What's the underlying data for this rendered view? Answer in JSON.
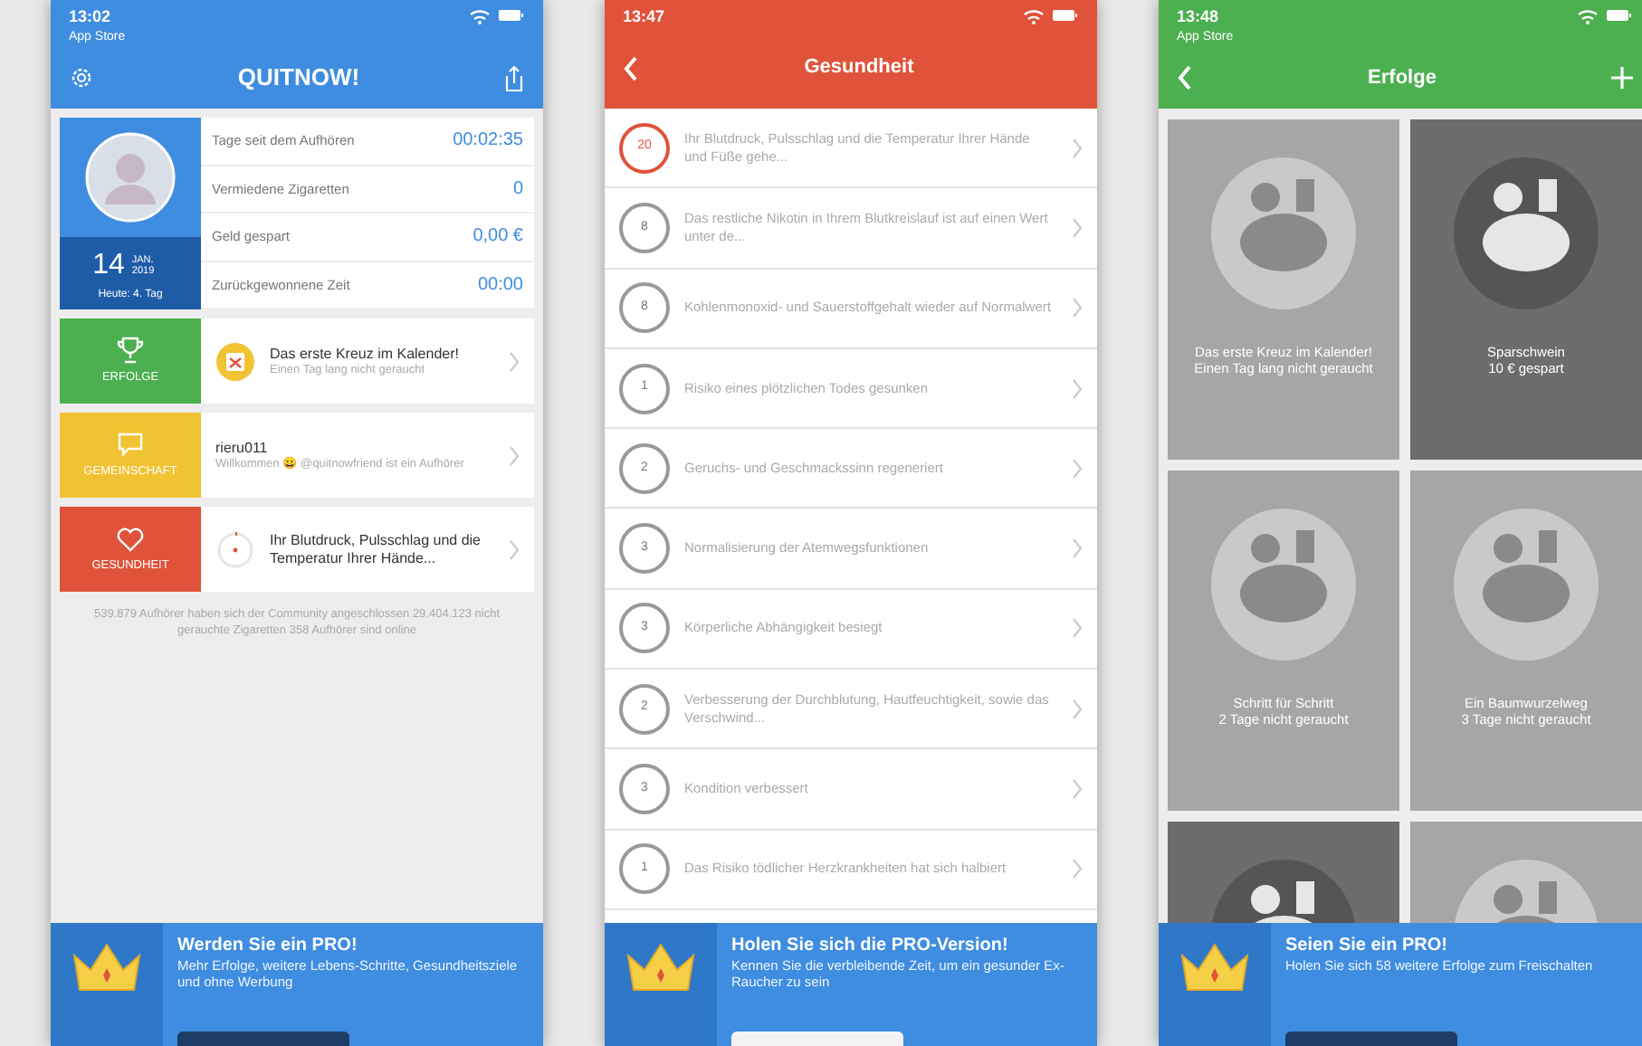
{
  "screens": [
    {
      "kind": "home",
      "status_bar": {
        "time": "13:02",
        "back_label": "App Store"
      },
      "title": "QUITNOW!",
      "profile": {
        "day": "14",
        "month_year": "JAN. 2019",
        "note": "Heute: 4. Tag"
      },
      "stats": [
        {
          "label": "Tage seit dem Aufhören",
          "value": "00:02:35"
        },
        {
          "label": "Vermiedene Zigaretten",
          "value": "0"
        },
        {
          "label": "Geld gespart",
          "value": "0,00 €"
        },
        {
          "label": "Zurückgewonnene Zeit",
          "value": "00:00"
        }
      ],
      "sections": [
        {
          "kind": "achievements",
          "label": "ERFOLGE",
          "color": "#4caf50",
          "title": "Das erste Kreuz im Kalender!",
          "subtitle": "Einen Tag lang nicht geraucht"
        },
        {
          "kind": "community",
          "label": "GEMEINSCHAFT",
          "color": "#f1c232",
          "title": "rieru011",
          "subtitle": "Willkommen 😀 @quitnowfriend ist ein Aufhörer"
        },
        {
          "kind": "health",
          "label": "GESUNDHEIT",
          "color": "#e0533a",
          "title": "Ihr Blutdruck, Pulsschlag und die Temperatur Ihrer Hände..."
        }
      ],
      "footer": "539.879 Aufhörer haben sich der Community angeschlossen 29.404.123 nicht gerauchte Zigaretten 358 Aufhörer sind online",
      "banner": {
        "title": "Werden Sie ein PRO!",
        "text": "Mehr Erfolge, weitere Lebens-Schritte, Gesundheitsziele und ohne Werbung",
        "button_dark": true
      }
    },
    {
      "kind": "health",
      "status_bar": {
        "time": "13:47"
      },
      "title": "Gesundheit",
      "items": [
        {
          "count": "20",
          "active": true,
          "text": "Ihr Blutdruck, Pulsschlag und die Temperatur Ihrer Hände und Füße gehe..."
        },
        {
          "count": "8",
          "active": false,
          "text": "Das restliche Nikotin in Ihrem Blutkreislauf ist auf einen Wert unter de..."
        },
        {
          "count": "8",
          "active": false,
          "text": "Kohlenmonoxid- und Sauerstoffgehalt wieder auf Normalwert"
        },
        {
          "count": "1",
          "active": false,
          "text": "Risiko eines plötzlichen Todes gesunken"
        },
        {
          "count": "2",
          "active": false,
          "text": "Geruchs- und Geschmackssinn regeneriert"
        },
        {
          "count": "3",
          "active": false,
          "text": "Normalisierung der Atemwegsfunktionen"
        },
        {
          "count": "3",
          "active": false,
          "text": "Körperliche Abhängigkeit besiegt"
        },
        {
          "count": "2",
          "active": false,
          "text": "Verbesserung der Durchblutung, Hautfeuchtigkeit, sowie das Verschwind..."
        },
        {
          "count": "3",
          "active": false,
          "text": "Kondition verbessert"
        },
        {
          "count": "1",
          "active": false,
          "text": "Das Risiko tödlicher Herzkrankheiten hat sich halbiert"
        }
      ],
      "banner": {
        "title": "Holen Sie sich die PRO-Version!",
        "text": "Kennen Sie die verbleibende Zeit, um ein gesunder Ex-Raucher zu sein",
        "button_dark": false
      }
    },
    {
      "kind": "achievements",
      "status_bar": {
        "time": "13:48",
        "back_label": "App Store"
      },
      "title": "Erfolge",
      "tiles": [
        {
          "unlocked": false,
          "title": "Das erste Kreuz im Kalender!",
          "subtitle": "Einen Tag lang nicht geraucht"
        },
        {
          "unlocked": true,
          "title": "Sparschwein",
          "subtitle": "10 € gespart"
        },
        {
          "unlocked": false,
          "title": "Schritt für Schritt",
          "subtitle": "2 Tage nicht geraucht"
        },
        {
          "unlocked": false,
          "title": "Ein Baumwurzelweg",
          "subtitle": "3 Tage nicht geraucht"
        },
        {
          "unlocked": true
        },
        {
          "unlocked": false
        }
      ],
      "banner": {
        "title": "Seien Sie ein PRO!",
        "text": "Holen Sie sich 58 weitere Erfolge zum Freischalten",
        "button_dark": true
      }
    }
  ]
}
